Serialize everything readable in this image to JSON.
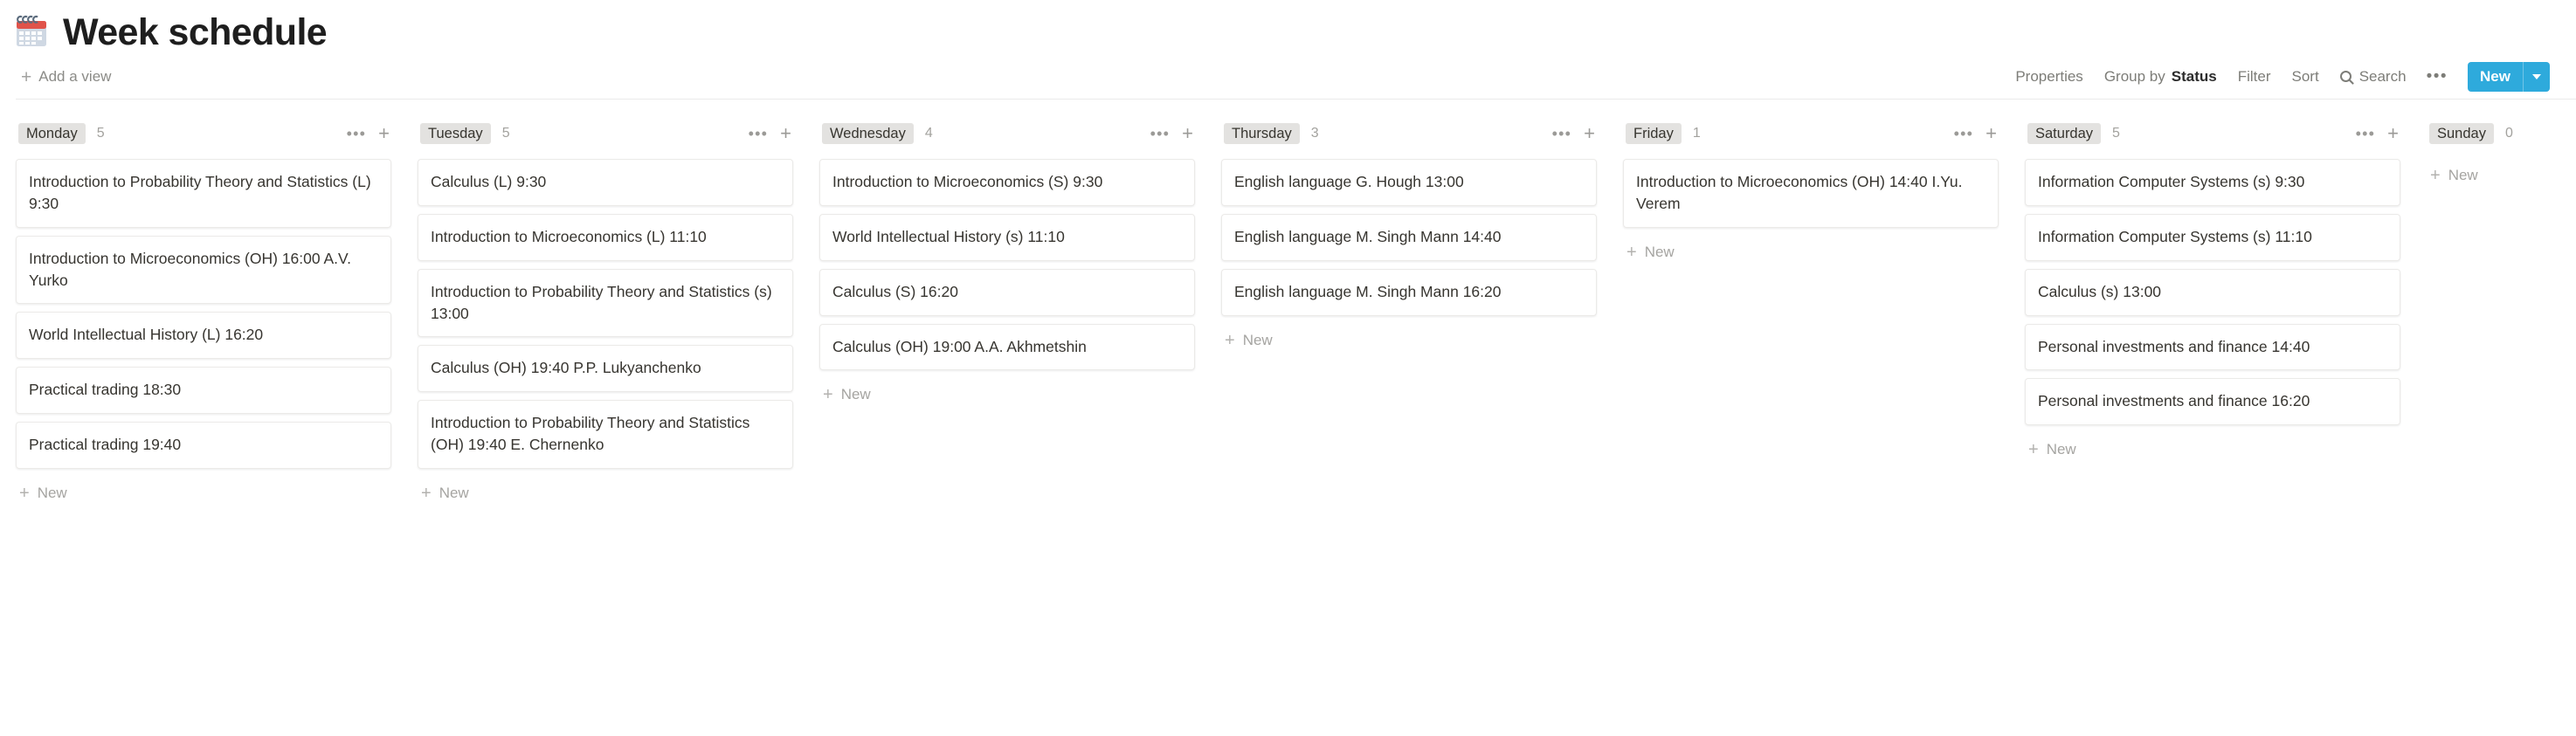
{
  "page": {
    "emoji_name": "spiral-calendar",
    "title": "Week schedule"
  },
  "view_bar": {
    "add_view_label": "Add a view",
    "toolbar": {
      "properties_label": "Properties",
      "group_by_label": "Group by",
      "group_by_value": "Status",
      "filter_label": "Filter",
      "sort_label": "Sort",
      "search_label": "Search",
      "more_label": "•••",
      "new_label": "New"
    }
  },
  "colors": {
    "accent_blue": "#2eaadc",
    "pill_background": "#e3e2e0",
    "card_border": "#ebeae8",
    "text_primary": "#373530",
    "text_muted": "#a3a29e"
  },
  "board": {
    "new_label": "New",
    "columns": [
      {
        "name": "Monday",
        "count": "5",
        "cards": [
          {
            "title": "Introduction to Probability Theory and Statistics (L) 9:30"
          },
          {
            "title": "Introduction to Microeconomics (OH) 16:00 A.V. Yurko"
          },
          {
            "title": "World Intellectual History (L) 16:20"
          },
          {
            "title": "Practical trading 18:30"
          },
          {
            "title": "Practical trading 19:40"
          }
        ]
      },
      {
        "name": "Tuesday",
        "count": "5",
        "cards": [
          {
            "title": "Calculus (L) 9:30"
          },
          {
            "title": "Introduction to Microeconomics (L) 11:10"
          },
          {
            "title": "Introduction to Probability Theory and Statistics (s) 13:00"
          },
          {
            "title": "Calculus (OH) 19:40 P.P. Lukyanchenko"
          },
          {
            "title": "Introduction to Probability Theory and Statistics (OH) 19:40 E. Chernenko"
          }
        ]
      },
      {
        "name": "Wednesday",
        "count": "4",
        "cards": [
          {
            "title": "Introduction to Microeconomics (S) 9:30"
          },
          {
            "title": "World Intellectual History (s) 11:10"
          },
          {
            "title": "Calculus (S) 16:20"
          },
          {
            "title": "Calculus (OH) 19:00 A.A. Akhmetshin"
          }
        ]
      },
      {
        "name": "Thursday",
        "count": "3",
        "cards": [
          {
            "title": "English language G. Hough 13:00"
          },
          {
            "title": "English language M. Singh Mann 14:40"
          },
          {
            "title": "English language M. Singh Mann 16:20"
          }
        ]
      },
      {
        "name": "Friday",
        "count": "1",
        "cards": [
          {
            "title": "Introduction to Microeconomics (OH) 14:40 I.Yu. Verem"
          }
        ]
      },
      {
        "name": "Saturday",
        "count": "5",
        "cards": [
          {
            "title": "Information Computer Systems (s) 9:30"
          },
          {
            "title": "Information Computer Systems (s) 11:10"
          },
          {
            "title": "Calculus (s) 13:00"
          },
          {
            "title": "Personal investments and finance 14:40"
          },
          {
            "title": "Personal investments and finance 16:20"
          }
        ]
      },
      {
        "name": "Sunday",
        "count": "0",
        "cards": []
      }
    ]
  }
}
